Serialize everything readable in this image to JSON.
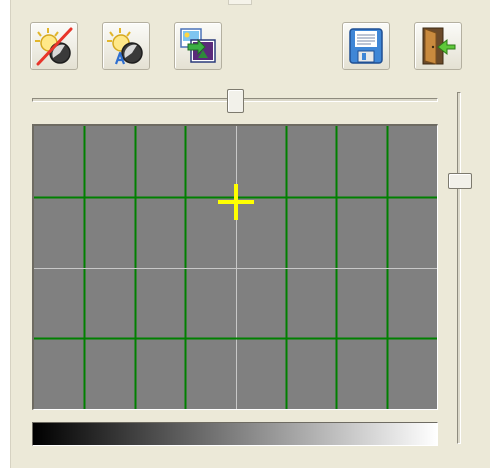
{
  "toolbar": {
    "buttons": [
      {
        "icon": "exposure-off-icon"
      },
      {
        "icon": "auto-exposure-icon"
      },
      {
        "icon": "picture-import-icon"
      },
      {
        "icon": "save-icon"
      },
      {
        "icon": "exit-door-icon"
      }
    ]
  },
  "sliders": {
    "horizontal_level": 0.5,
    "vertical_level": 0.25
  },
  "grid": {
    "columns": 8,
    "rows": 4,
    "background_color": "#808080",
    "line_color": "#008000",
    "center_line_color": "#c8c8c8",
    "crosshair_color": "#ffff00",
    "crosshair_position": [
      0.5,
      0.27
    ]
  },
  "gradient": {
    "from_color": "#000000",
    "to_color": "#ffffff"
  }
}
